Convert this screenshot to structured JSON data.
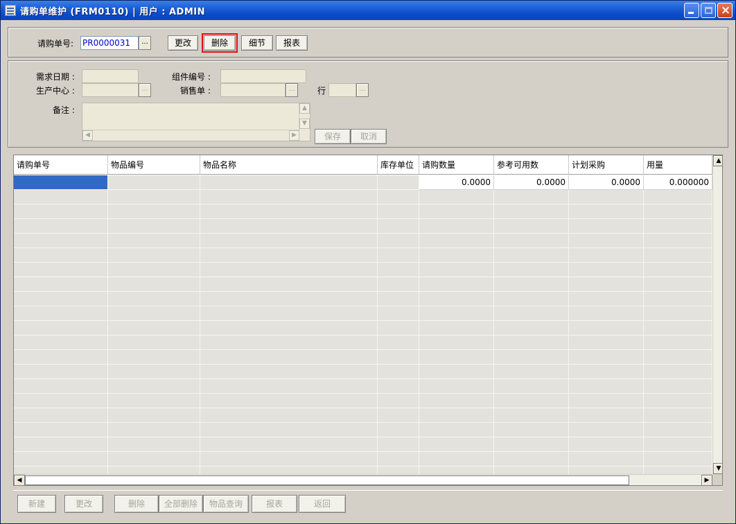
{
  "window": {
    "title": "请购单维护 (FRM0110) | 用户 : ADMIN"
  },
  "toolbar": {
    "pr_no_label": "请购单号:",
    "pr_no_value": "PR0000031",
    "lookup_glyph": "...",
    "edit_label": "更改",
    "delete_label": "删除",
    "detail_label": "细节",
    "report_label": "报表"
  },
  "form": {
    "required_date_label": "需求日期 :",
    "component_no_label": "组件编号 :",
    "production_center_label": "生产中心 :",
    "sales_order_label": "销售单 :",
    "line_label": "行 :",
    "remark_label": "备注 :",
    "save_label": "保存",
    "cancel_label": "取消"
  },
  "grid": {
    "columns": [
      "请购单号",
      "物品编号",
      "物品名称",
      "库存单位",
      "请购数量",
      "参考可用数",
      "计划采购",
      "用量"
    ],
    "rows": [
      [
        "",
        "",
        "",
        "",
        "0.0000",
        "0.0000",
        "0.0000",
        "0.000000"
      ]
    ]
  },
  "bottom_buttons": {
    "new_label": "新建",
    "edit_label": "更改",
    "delete_label": "删除",
    "delete_all_label": "全部删除",
    "item_query_label": "物品查询",
    "report_label": "报表",
    "back_label": "返回"
  },
  "colors": {
    "highlight": "#e01010",
    "selection": "#316ac5",
    "title_bar": "#0b4bc8"
  }
}
